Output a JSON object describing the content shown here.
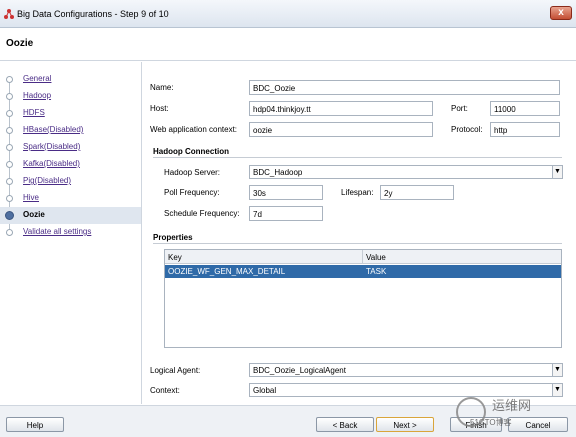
{
  "window": {
    "title": "Big Data Configurations - Step 9 of 10",
    "close_glyph": "x"
  },
  "header": {
    "title": "Oozie"
  },
  "sidebar": {
    "items": [
      {
        "label": "General",
        "state": "done"
      },
      {
        "label": "Hadoop",
        "state": "done"
      },
      {
        "label": "HDFS",
        "state": "done"
      },
      {
        "label": "HBase(Disabled)",
        "state": "done"
      },
      {
        "label": "Spark(Disabled)",
        "state": "done"
      },
      {
        "label": "Kafka(Disabled)",
        "state": "done"
      },
      {
        "label": "Pig(Disabled)",
        "state": "done"
      },
      {
        "label": "Hive",
        "state": "done"
      },
      {
        "label": "Oozie",
        "state": "active"
      },
      {
        "label": "Validate all settings",
        "state": "todo"
      }
    ]
  },
  "form": {
    "name_label": "Name:",
    "name_value": "BDC_Oozie",
    "host_label": "Host:",
    "host_value": "hdp04.thinkjoy.tt",
    "port_label": "Port:",
    "port_value": "11000",
    "webctx_label": "Web application context:",
    "webctx_value": "oozie",
    "protocol_label": "Protocol:",
    "protocol_value": "http"
  },
  "hadoop": {
    "section_title": "Hadoop Connection",
    "server_label": "Hadoop Server:",
    "server_value": "BDC_Hadoop",
    "poll_label": "Poll Frequency:",
    "poll_value": "30s",
    "lifespan_label": "Lifespan:",
    "lifespan_value": "2y",
    "schedule_label": "Schedule Frequency:",
    "schedule_value": "7d"
  },
  "properties": {
    "section_title": "Properties",
    "columns": [
      "Key",
      "Value"
    ],
    "rows": [
      {
        "key": "OOZIE_WF_GEN_MAX_DETAIL",
        "value": "TASK"
      }
    ]
  },
  "bottom": {
    "agent_label": "Logical Agent:",
    "agent_value": "BDC_Oozie_LogicalAgent",
    "context_label": "Context:",
    "context_value": "Global"
  },
  "footer": {
    "help": "Help",
    "back": "< Back",
    "next": "Next >",
    "finish": "Finish",
    "cancel": "Cancel"
  },
  "watermark": {
    "cn": "运维网",
    "en": "51CTO博客"
  },
  "colors": {
    "selection": "#2f6aa8",
    "visited_link": "#4a2c86",
    "active_step": "#dfe6ef"
  }
}
